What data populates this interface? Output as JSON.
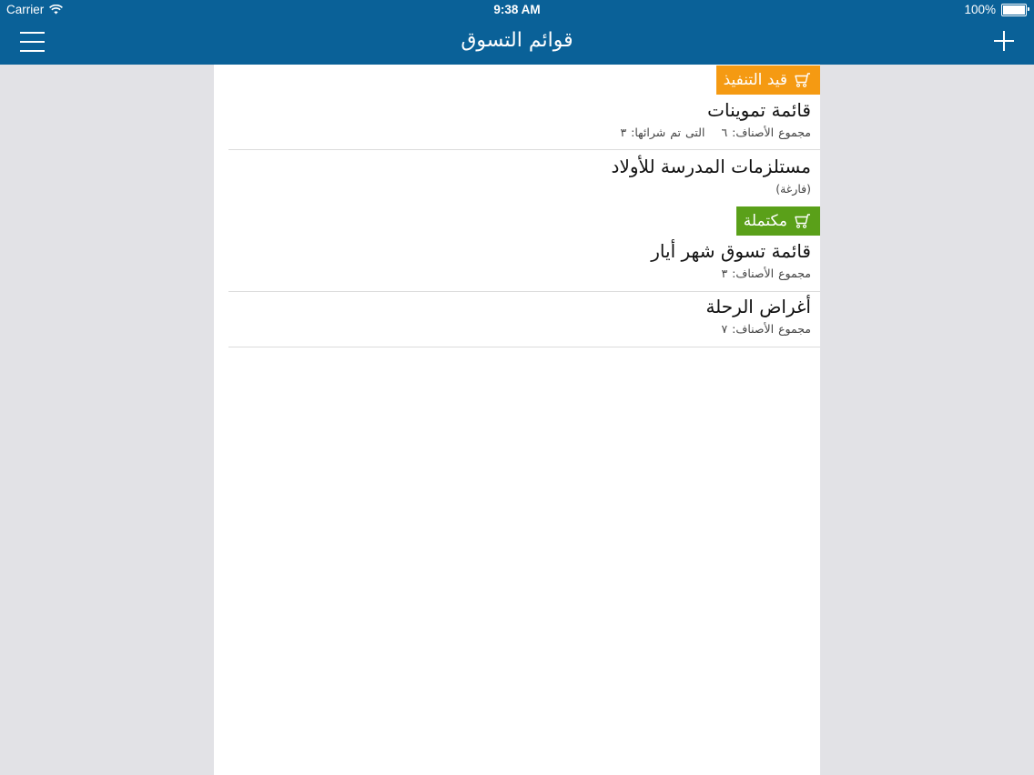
{
  "status_bar": {
    "carrier": "Carrier",
    "time": "9:38 AM",
    "battery": "100%"
  },
  "nav": {
    "title": "قوائم التسوق",
    "menu_icon": "hamburger-icon",
    "add_icon": "plus-icon"
  },
  "sections": [
    {
      "label": "قيد التنفيذ",
      "icon": "cart-icon",
      "color": "#f59a12",
      "items": [
        {
          "title": "قائمة تموينات",
          "total": "مجموع الأصناف: ٦",
          "bought": "التى تم شرائها: ٣"
        },
        {
          "title": "مستلزمات المدرسة للأولاد",
          "total": "(فارغة)"
        }
      ]
    },
    {
      "label": "مكتملة",
      "icon": "cart-icon",
      "color": "#5aa019",
      "items": [
        {
          "title": "قائمة تسوق شهر أيار",
          "total": "مجموع الأصناف: ٣"
        },
        {
          "title": "أغراض الرحلة",
          "total": "مجموع الأصناف: ٧"
        }
      ]
    }
  ],
  "colors": {
    "header": "#0a6198",
    "background": "#e2e2e6"
  }
}
